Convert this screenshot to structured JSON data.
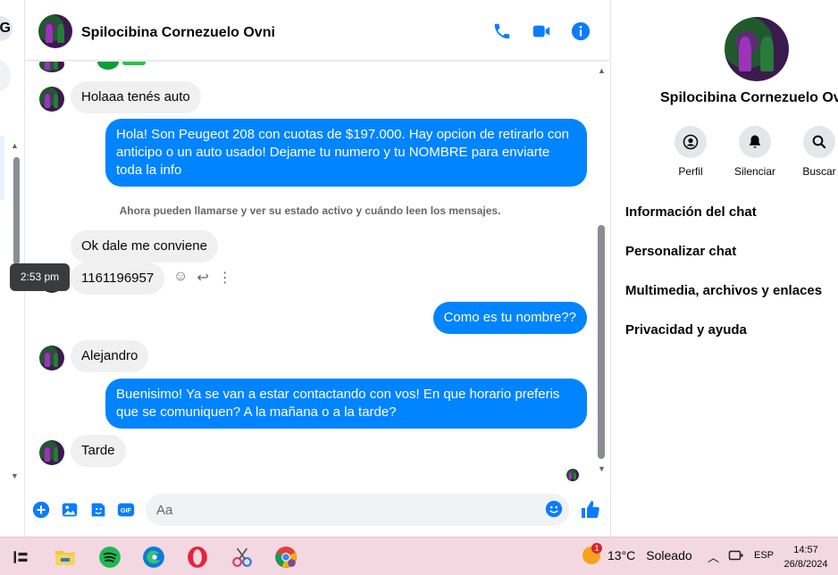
{
  "left_strip": {
    "g_letter": "G"
  },
  "header": {
    "contact_name": "Spilocibina Cornezuelo Ovni"
  },
  "messages": [
    {
      "dir": "in",
      "text": "Holaaa tenés auto"
    },
    {
      "dir": "out",
      "text": "Hola! Son Peugeot 208 con cuotas de $197.000. Hay opcion de retirarlo con anticipo o un auto usado! Dejame tu numero y tu NOMBRE para enviarte toda la info"
    },
    {
      "dir": "system",
      "text": "Ahora pueden llamarse y ver su estado activo y cuándo leen los mensajes."
    },
    {
      "dir": "in",
      "text": "Ok dale me conviene"
    },
    {
      "dir": "in",
      "text": "1161196957"
    },
    {
      "dir": "out",
      "text": "Como es tu nombre??"
    },
    {
      "dir": "in",
      "text": "Alejandro"
    },
    {
      "dir": "out",
      "text": "Buenisimo! Ya se van a estar contactando con vos! En que horario preferis que se comuniquen? A la mañana o a la tarde?"
    },
    {
      "dir": "in",
      "text": "Tarde"
    }
  ],
  "tooltip": {
    "time": "2:53 pm"
  },
  "composer": {
    "placeholder": "Aa",
    "value": ""
  },
  "right_panel": {
    "name": "Spilocibina Cornezuelo Ovni",
    "actions": [
      {
        "label": "Perfil",
        "icon": "profile-icon"
      },
      {
        "label": "Silenciar",
        "icon": "bell-icon"
      },
      {
        "label": "Buscar",
        "icon": "search-icon"
      }
    ],
    "menu": [
      "Información del chat",
      "Personalizar chat",
      "Multimedia, archivos y enlaces",
      "Privacidad y ayuda"
    ]
  },
  "taskbar": {
    "weather_temp": "13°C",
    "weather_desc": "Soleado",
    "weather_badge": "1",
    "lang": "ESP",
    "time": "14:57",
    "date": "26/8/2024"
  },
  "colors": {
    "accent": "#0084ff",
    "incoming_bubble": "#f0f0f0",
    "taskbar": "#f3d8e2"
  }
}
